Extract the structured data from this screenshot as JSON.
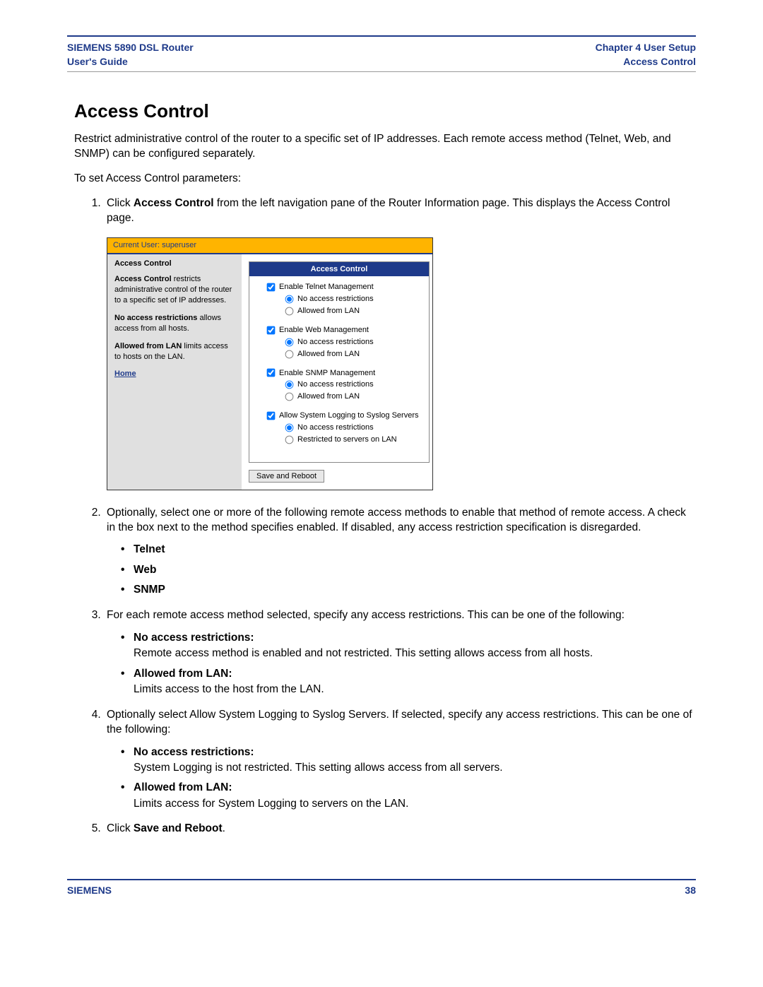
{
  "header": {
    "left_line1": "SIEMENS 5890 DSL Router",
    "left_line2": "User's Guide",
    "right_line1": "Chapter 4  User Setup",
    "right_line2": "Access Control"
  },
  "title": "Access Control",
  "intro1": "Restrict administrative control of the router to a specific set of IP addresses. Each remote access method (Telnet, Web, and SNMP) can be configured separately.",
  "intro2": "To set Access Control parameters:",
  "steps": {
    "s1a": "Click ",
    "s1b": "Access Control",
    "s1c": " from the left navigation pane of the Router Information page. This displays the Access Control page.",
    "s2": "Optionally, select one or more of the following remote access methods to enable that method of remote access. A check in the box next to the method specifies enabled. If disabled, any access restriction specification is disregarded.",
    "s2_items": [
      "Telnet",
      "Web",
      "SNMP"
    ],
    "s3": "For each remote access method selected, specify any access restrictions. This can be one of the following:",
    "s3_items": [
      {
        "h": "No access restrictions:",
        "d": "Remote access method is enabled and not restricted. This setting allows access from all hosts."
      },
      {
        "h": "Allowed from LAN:",
        "d": "Limits access to the host from the LAN."
      }
    ],
    "s4": "Optionally select Allow System Logging to Syslog Servers. If selected, specify any access restrictions. This can be one of the following:",
    "s4_items": [
      {
        "h": "No access restrictions:",
        "d": "System Logging is not restricted. This setting allows access from all servers."
      },
      {
        "h": "Allowed from LAN:",
        "d": "Limits access for System Logging to servers on the LAN."
      }
    ],
    "s5a": "Click ",
    "s5b": "Save and Reboot",
    "s5c": "."
  },
  "shot": {
    "banner": "Current User: superuser",
    "side_title": "Access Control",
    "side_p1a": "Access Control",
    "side_p1b": " restricts administrative control of the router to a specific set of IP addresses.",
    "side_p2a": "No access restrictions",
    "side_p2b": " allows access from all hosts.",
    "side_p3a": "Allowed from LAN",
    "side_p3b": " limits access to hosts on the LAN.",
    "side_home": "Home",
    "panel_title": "Access Control",
    "groups": [
      {
        "chk": "Enable Telnet Management",
        "r1": "No access restrictions",
        "r2": "Allowed from LAN"
      },
      {
        "chk": "Enable Web Management",
        "r1": "No access restrictions",
        "r2": "Allowed from LAN"
      },
      {
        "chk": "Enable SNMP Management",
        "r1": "No access restrictions",
        "r2": "Allowed from LAN"
      },
      {
        "chk": "Allow System Logging to Syslog Servers",
        "r1": "No access restrictions",
        "r2": "Restricted to servers on LAN"
      }
    ],
    "save_btn": "Save and Reboot"
  },
  "footer": {
    "brand": "SIEMENS",
    "page": "38"
  }
}
